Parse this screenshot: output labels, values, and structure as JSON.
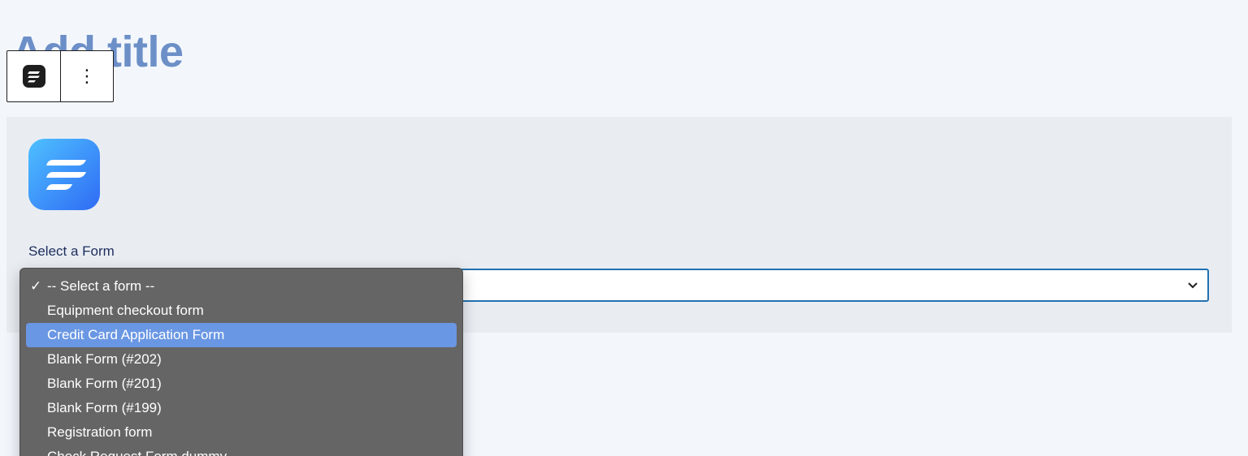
{
  "editor": {
    "title_placeholder": "Add title"
  },
  "block_toolbar": {
    "block_icon": "fluent-forms-icon",
    "more_options_label": "⋮"
  },
  "block": {
    "logo_icon": "fluent-forms-logo-icon",
    "field_label": "Select a Form",
    "select": {
      "selected_value": "-- Select a form --",
      "options": [
        {
          "label": "-- Select a form --",
          "checked": true,
          "highlighted": false
        },
        {
          "label": "Equipment checkout form",
          "checked": false,
          "highlighted": false
        },
        {
          "label": "Credit Card Application Form",
          "checked": false,
          "highlighted": true
        },
        {
          "label": "Blank Form (#202)",
          "checked": false,
          "highlighted": false
        },
        {
          "label": "Blank Form (#201)",
          "checked": false,
          "highlighted": false
        },
        {
          "label": "Blank Form (#199)",
          "checked": false,
          "highlighted": false
        },
        {
          "label": "Registration form",
          "checked": false,
          "highlighted": false
        },
        {
          "label": "Check Request Form dummy",
          "checked": false,
          "highlighted": false
        }
      ],
      "check_glyph": "✓"
    }
  },
  "colors": {
    "accent": "#2271b1",
    "highlight": "#6a97e3",
    "menu_bg": "#666566",
    "logo_gradient_start": "#4ec0ff",
    "logo_gradient_end": "#2f6bf5"
  }
}
